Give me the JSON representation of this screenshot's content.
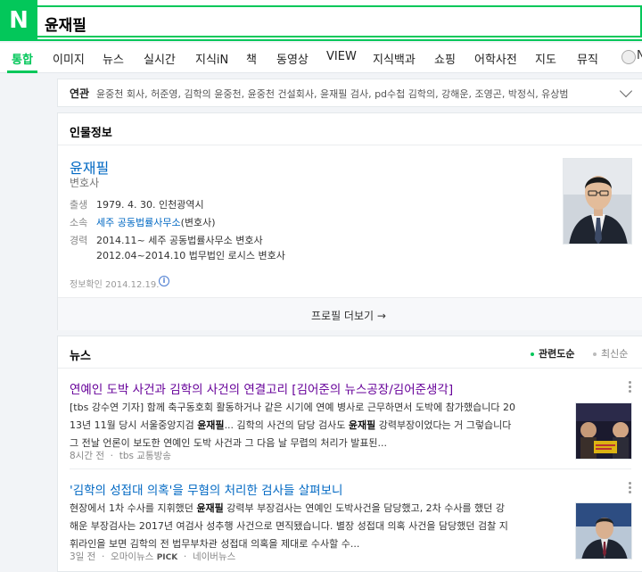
{
  "search": {
    "logo": "N",
    "query": "윤재필"
  },
  "nav": {
    "items": [
      "통합",
      "이미지",
      "뉴스",
      "실시간",
      "지식iN",
      "책",
      "동영상",
      "VIEW",
      "지식백과",
      "쇼핑",
      "어학사전",
      "지도",
      "뮤직"
    ],
    "active": "통합",
    "user_initial": "N"
  },
  "related": {
    "title": "연관",
    "terms": "윤중천 회사, 허준영, 김학의 윤중천, 윤중천 건설회사, 윤재필 검사, pd수첩 김학의, 강해운, 조영곤, 박정식, 유상범"
  },
  "profile": {
    "section_title": "인물정보",
    "name": "윤재필",
    "job": "변호사",
    "birth_label": "출생",
    "birth_value": "1979. 4. 30. 인천광역시",
    "affil_label": "소속",
    "affil_link": "세주 공동법률사무소",
    "affil_suffix": "(변호사)",
    "career_label": "경력",
    "career_1": "2014.11~ 세주 공동법률사무소 변호사",
    "career_2": "2012.04~2014.10 법무법인 로시스 변호사",
    "info_date": "정보확인 2014.12.19.",
    "more_label": "프로필 더보기 →"
  },
  "news": {
    "section_title": "뉴스",
    "option_related": "관련도순",
    "option_latest": "최신순",
    "articles": [
      {
        "title": "연예인 도박 사건과 김학의 사건의 연결고리 [김어준의 뉴스공장/김어준생각]",
        "line1_pre": "[tbs 강수연 기자] 함께 축구동호회 활동하거나 같은 시기에 연예 병사로 근무하면서 도박에 참가했습니다 20",
        "line2_a": "13년 11월 당시 서울중앙지검 ",
        "line2_b": "윤재필",
        "line2_c": "... 김학의 사건의 담당 검사도 ",
        "line2_d": "윤재필",
        "line2_e": " 강력부장이었다는 거 그렇습니다",
        "line3": "그 전날 언론이 보도한 연예인 도박 사건과 그 다음 날 무렵의 처리가 발표된...",
        "time": "8시간 전",
        "source": "tbs 교통방송"
      },
      {
        "title": "'김학의 성접대 의혹'을 무혐의 처리한 검사들 살펴보니",
        "line1_a": "현장에서 1차 수사를 지휘했던 ",
        "line1_b": "윤재필",
        "line1_c": " 강력부 부장검사는 연예인 도박사건을 담당했고, 2차 수사를 했던 강",
        "line2": "해운 부장검사는 2017년 여검사 성추행 사건으로 면직됐습니다. 별장 성접대 의혹 사건을 담당했던 검찰 지",
        "line3": "휘라인을 보면 김학의 전 법무부차관 성접대 의혹을 제대로 수사할 수...",
        "time": "3일 전",
        "source": "오마이뉴스",
        "pick": "PICK",
        "extra": "네이버뉴스"
      }
    ]
  },
  "colors": {
    "brand": "#03c75a",
    "link": "#0068c3",
    "visited": "#660099",
    "accent": "#03c75a"
  }
}
